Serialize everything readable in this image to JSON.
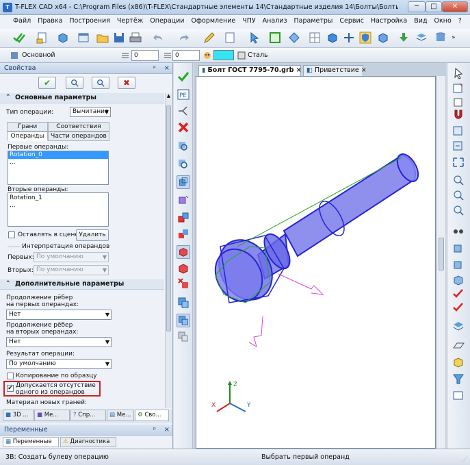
{
  "window": {
    "title": "T-FLEX CAD x64 - C:\\Program Files (x86)\\T-FLEX\\Стандартные элементы 14\\Стандартные изделия 14\\Болты\\Болты с подголовком...",
    "logo": "T",
    "min_label": "─",
    "max_label": "□",
    "close_label": "✕"
  },
  "menu": [
    "Файл",
    "Правка",
    "Построения",
    "Чертёж",
    "Операции",
    "Оформление",
    "ЧПУ",
    "Анализ",
    "Параметры",
    "Сервис",
    "Настройка",
    "Вид",
    "Окно",
    "?"
  ],
  "toolbar2": {
    "layer": "Основной",
    "level_value": "0",
    "priority_value": "0",
    "material": "Сталь",
    "color_swatch": "#33e6f2"
  },
  "left_panel": {
    "header": "Свойства",
    "ok_glyph": "✔",
    "cancel_glyph": "✖",
    "section_main": "Основные параметры",
    "op_type_label": "Тип операции:",
    "op_type_value": "Вычитание",
    "tabs_row1": [
      "Грани",
      "Соответствия"
    ],
    "tabs_row2": [
      "Операнды",
      "Части операндов"
    ],
    "first_operands_label": "Первые операнды:",
    "first_operands": [
      "Rotation_0",
      "..."
    ],
    "second_operands_label": "Вторые операнды:",
    "second_operands": [
      "Rotation_1",
      "..."
    ],
    "keep_in_scene": "Оставлять в сцене",
    "delete_button": "Удалить",
    "interp_group": "Интерпретация операндов",
    "first_label": "Первых:",
    "first_value": "По умолчанию",
    "second_label": "Вторых:",
    "second_value": "По умолчанию",
    "section_extra": "Дополнительные параметры",
    "ext_first_label_1": "Продолжение рёбер",
    "ext_first_label_2": "на первых операндах:",
    "ext_first_value": "Нет",
    "ext_second_label_1": "Продолжение рёбер",
    "ext_second_label_2": "на вторых операндах:",
    "ext_second_value": "Нет",
    "result_label": "Результат операции:",
    "result_value": "По умолчанию",
    "copy_by_sample": "Копирование по образцу",
    "allow_missing_1": "Допускается отсутствие",
    "allow_missing_2": "одного из операндов",
    "allow_missing_checked": "✔",
    "new_faces_material": "Материал новых граней:",
    "bottom_tabs": [
      "3D ...",
      "Ме...",
      "Спр...",
      "Ме...",
      "Сво..."
    ]
  },
  "variables_panel": {
    "header": "Переменные",
    "tabs": [
      "Переменные",
      "Диагностика"
    ]
  },
  "document_tabs": [
    "Болт ГОСТ 7795-70.grb",
    "Приветствие"
  ],
  "axes": {
    "x": "X",
    "y": "Y",
    "z": "Z"
  },
  "status": {
    "left": "3В: Создать булеву операцию",
    "center": "Выбрать первый операнд"
  },
  "colors": {
    "accent_red": "#cc2222",
    "bolt_fill": "#7070e8",
    "bolt_edge": "#2020d0",
    "construction": "#e040e0",
    "green": "#22aa22"
  }
}
